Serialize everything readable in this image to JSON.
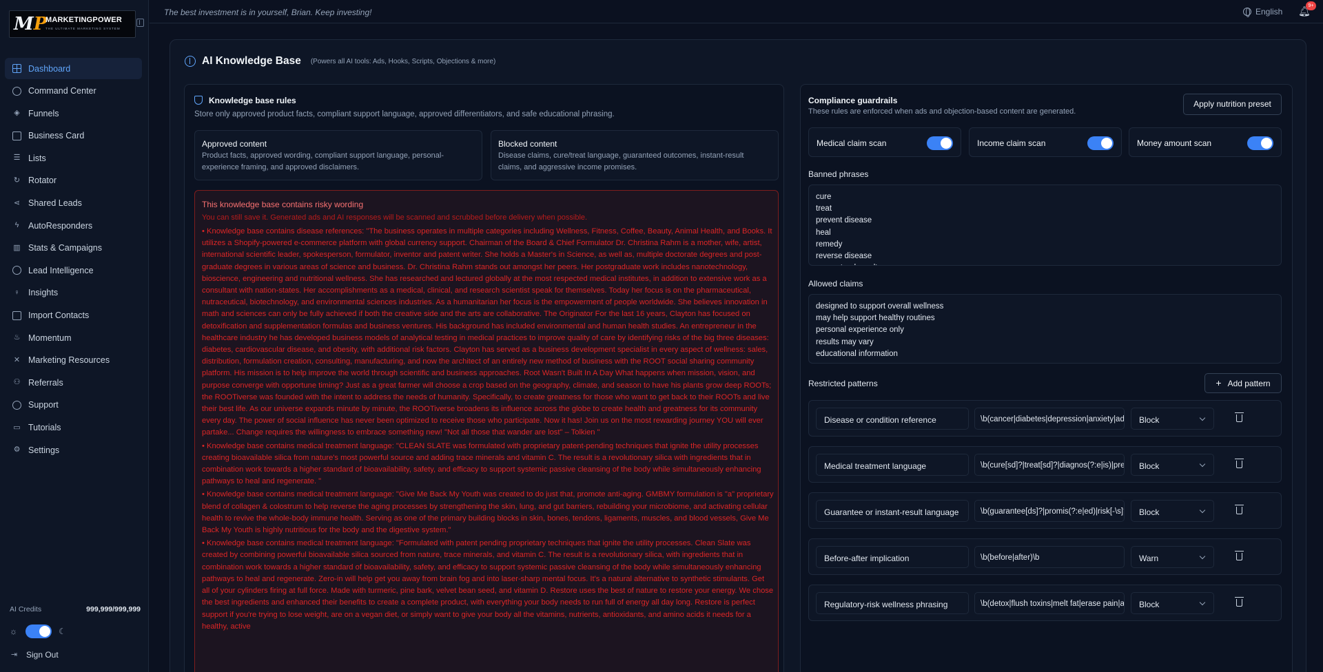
{
  "brand": {
    "logo_text": "MARKETINGPOWER",
    "logo_sub": "THE ULTIMATE MARKETING SYSTEM"
  },
  "sidebar": {
    "items": [
      {
        "label": "Dashboard",
        "icon": "grid-icon",
        "active": true
      },
      {
        "label": "Command Center",
        "icon": "target-icon"
      },
      {
        "label": "Funnels",
        "icon": "layers-icon"
      },
      {
        "label": "Business Card",
        "icon": "card-icon"
      },
      {
        "label": "Lists",
        "icon": "list-icon"
      },
      {
        "label": "Rotator",
        "icon": "rotate-icon"
      },
      {
        "label": "Shared Leads",
        "icon": "share-icon"
      },
      {
        "label": "AutoResponders",
        "icon": "bolt-icon"
      },
      {
        "label": "Stats & Campaigns",
        "icon": "bar-chart-icon"
      },
      {
        "label": "Lead Intelligence",
        "icon": "dollar-icon"
      },
      {
        "label": "Insights",
        "icon": "lightbulb-icon"
      },
      {
        "label": "Import Contacts",
        "icon": "import-icon"
      },
      {
        "label": "Momentum",
        "icon": "flame-icon"
      },
      {
        "label": "Marketing Resources",
        "icon": "tools-icon"
      },
      {
        "label": "Referrals",
        "icon": "users-icon"
      },
      {
        "label": "Support",
        "icon": "lifebuoy-icon"
      },
      {
        "label": "Tutorials",
        "icon": "book-icon"
      },
      {
        "label": "Settings",
        "icon": "gear-icon"
      }
    ],
    "credits_label": "AI Credits",
    "credits_value": "999,999/999,999",
    "sign_out": "Sign Out"
  },
  "topbar": {
    "motto": "The best investment is in yourself, Brian. Keep investing!",
    "language": "English",
    "notifications": "9+"
  },
  "page": {
    "title": "AI Knowledge Base",
    "subtitle": "(Powers all AI tools: Ads, Hooks, Scripts, Objections & more)"
  },
  "rules": {
    "title": "Knowledge base rules",
    "desc": "Store only approved product facts, compliant support language, approved differentiators, and safe educational phrasing.",
    "approved": {
      "title": "Approved content",
      "desc": "Product facts, approved wording, compliant support language, personal-experience framing, and approved disclaimers."
    },
    "blocked": {
      "title": "Blocked content",
      "desc": "Disease claims, cure/treat language, guaranteed outcomes, instant-result claims, and aggressive income promises."
    }
  },
  "warning": {
    "title": "This knowledge base contains risky wording",
    "subtitle": "You can still save it. Generated ads and AI responses will be scanned and scrubbed before delivery when possible.",
    "items": [
      "• Knowledge base contains disease references: \"The business operates in multiple categories including Wellness, Fitness, Coffee, Beauty, Animal Health, and Books. It utilizes a Shopify-powered e-commerce platform with global currency support. Chairman of the Board & Chief Formulator Dr. Christina Rahm is a mother, wife, artist, international scientific leader, spokesperson, formulator, inventor and patent writer. She holds a Master's in Science, as well as, multiple doctorate degrees and post-graduate degrees in various areas of science and business. Dr. Christina Rahm stands out amongst her peers. Her postgraduate work includes nanotechnology, bioscience, engineering and nutritional wellness. She has researched and lectured globally at the most respected medical institutes, in addition to extensive work as a consultant with nation-states. Her accomplishments as a medical, clinical, and research scientist speak for themselves. Today her focus is on the pharmaceutical, nutraceutical, biotechnology, and environmental sciences industries. As a humanitarian her focus is the empowerment of people worldwide. She believes innovation in math and sciences can only be fully achieved if both the creative side and the arts are collaborative. The Originator For the last 16 years, Clayton has focused on detoxification and supplementation formulas and business ventures. His background has included environmental and human health studies. An entrepreneur in the healthcare industry he has developed business models of analytical testing in medical practices to improve quality of care by identifying risks of the big three diseases: diabetes, cardiovascular disease, and obesity, with additional risk factors. Clayton has served as a business development specialist in every aspect of wellness: sales, distribution, formulation creation, consulting, manufacturing, and now the architect of an entirely new method of business with the ROOT social sharing community platform. His mission is to help improve the world through scientific and business approaches. Root Wasn't Built In A Day What happens when mission, vision, and purpose converge with opportune timing? Just as a great farmer will choose a crop based on the geography, climate, and season to have his plants grow deep ROOTs; the ROOTiverse was founded with the intent to address the needs of humanity. Specifically, to create greatness for those who want to get back to their ROOTs and live their best life. As our universe expands minute by minute, the ROOTiverse broadens its influence across the globe to create health and greatness for its community every day. The power of social influence has never been optimized to receive those who participate. Now it has! Join us on the most rewarding journey YOU will ever partake... Change requires the willingness to embrace something new! \"Not all those that wander are lost\" – Tolkien \"",
      "• Knowledge base contains medical treatment language: \"CLEAN SLATE was formulated with proprietary patent-pending techniques that ignite the utility processes creating bioavailable silica from nature's most powerful source and adding trace minerals and vitamin C. The result is a revolutionary silica with ingredients that in combination work towards a higher standard of bioavailability, safety, and efficacy to support systemic passive cleansing of the body while simultaneously enhancing pathways to heal and regenerate. \"",
      "• Knowledge base contains medical treatment language: \"Give Me Back My Youth was created to do just that, promote anti-aging. GMBMY formulation is \"a\" proprietary blend of collagen & colostrum to help reverse the aging processes by strengthening the skin, lung, and gut barriers, rebuilding your microbiome, and activating cellular health to revive the whole-body immune health. Serving as one of the primary building blocks in skin, bones, tendons, ligaments, muscles, and blood vessels, Give Me Back My Youth is highly nutritious for the body and the digestive system.\"",
      "• Knowledge base contains medical treatment language: \"Formulated with patent pending proprietary techniques that ignite the utility processes. Clean Slate was created by combining powerful bioavailable silica sourced from nature, trace minerals, and vitamin C. The result is a revolutionary silica, with ingredients that in combination work towards a higher standard of bioavailability, safety, and efficacy to support systemic passive cleansing of the body while simultaneously enhancing pathways to heal and regenerate. Zero-in will help get you away from brain fog and into laser-sharp mental focus. It's a natural alternative to synthetic stimulants. Get all of your cylinders firing at full force. Made with turmeric, pine bark, velvet bean seed, and vitamin D. Restore uses the best of nature to restore your energy. We chose the best ingredients and enhanced their benefits to create a complete product, with everything your body needs to run full of energy all day long. Restore is perfect support if you're trying to lose weight, are on a vegan diet, or simply want to give your body all the vitamins, nutrients, antioxidants, and amino acids it needs for a healthy, active"
    ]
  },
  "compliance": {
    "title": "Compliance guardrails",
    "desc": "These rules are enforced when ads and objection-based content are generated.",
    "preset_button": "Apply nutrition preset",
    "scans": [
      {
        "label": "Medical claim scan",
        "on": true
      },
      {
        "label": "Income claim scan",
        "on": true
      },
      {
        "label": "Money amount scan",
        "on": true
      }
    ],
    "banned_label": "Banned phrases",
    "banned": "cure\ntreat\nprevent disease\nheal\nremedy\nreverse disease\nguaranteed results",
    "allowed_label": "Allowed claims",
    "allowed": "designed to support overall wellness\nmay help support healthy routines\npersonal experience only\nresults may vary\neducational information",
    "patterns_label": "Restricted patterns",
    "add_pattern": "Add pattern",
    "patterns": [
      {
        "name": "Disease or condition reference",
        "regex": "\\b(cancer|diabetes|depression|anxiety|adhd|",
        "action": "Block"
      },
      {
        "name": "Medical treatment language",
        "regex": "\\b(cure[sd]?|treat[sd]?|diagnos(?:e|is)|preve",
        "action": "Block"
      },
      {
        "name": "Guarantee or instant-result language",
        "regex": "\\b(guarantee[ds]?|promis(?:e|ed)|risk[-\\s]?fr",
        "action": "Block"
      },
      {
        "name": "Before-after implication",
        "regex": "\\b(before|after)\\b",
        "action": "Warn"
      },
      {
        "name": "Regulatory-risk wellness phrasing",
        "regex": "\\b(detox|flush toxins|melt fat|erase pain|anti[",
        "action": "Block"
      }
    ]
  }
}
